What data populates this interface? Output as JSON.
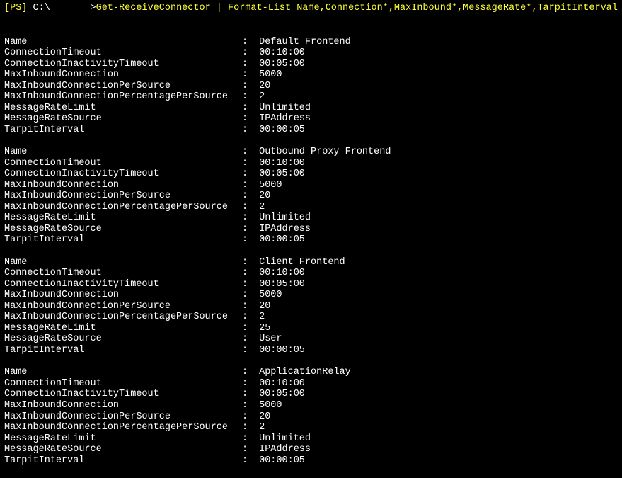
{
  "prompt": {
    "prefix": "[PS] ",
    "path": "C:\\",
    "gap": "       ",
    "marker": ">",
    "command": "Get-ReceiveConnector | Format-List Name,Connection*,MaxInbound*,MessageRate*,TarpitInterval"
  },
  "fields": [
    "Name",
    "ConnectionTimeout",
    "ConnectionInactivityTimeout",
    "MaxInboundConnection",
    "MaxInboundConnectionPerSource",
    "MaxInboundConnectionPercentagePerSource",
    "MessageRateLimit",
    "MessageRateSource",
    "TarpitInterval"
  ],
  "separator": ":",
  "records": [
    {
      "Name": "Default Frontend",
      "ConnectionTimeout": "00:10:00",
      "ConnectionInactivityTimeout": "00:05:00",
      "MaxInboundConnection": "5000",
      "MaxInboundConnectionPerSource": "20",
      "MaxInboundConnectionPercentagePerSource": "2",
      "MessageRateLimit": "Unlimited",
      "MessageRateSource": "IPAddress",
      "TarpitInterval": "00:00:05"
    },
    {
      "Name": "Outbound Proxy Frontend",
      "ConnectionTimeout": "00:10:00",
      "ConnectionInactivityTimeout": "00:05:00",
      "MaxInboundConnection": "5000",
      "MaxInboundConnectionPerSource": "20",
      "MaxInboundConnectionPercentagePerSource": "2",
      "MessageRateLimit": "Unlimited",
      "MessageRateSource": "IPAddress",
      "TarpitInterval": "00:00:05"
    },
    {
      "Name": "Client Frontend",
      "ConnectionTimeout": "00:10:00",
      "ConnectionInactivityTimeout": "00:05:00",
      "MaxInboundConnection": "5000",
      "MaxInboundConnectionPerSource": "20",
      "MaxInboundConnectionPercentagePerSource": "2",
      "MessageRateLimit": "25",
      "MessageRateSource": "User",
      "TarpitInterval": "00:00:05"
    },
    {
      "Name": "ApplicationRelay",
      "ConnectionTimeout": "00:10:00",
      "ConnectionInactivityTimeout": "00:05:00",
      "MaxInboundConnection": "5000",
      "MaxInboundConnectionPerSource": "20",
      "MaxInboundConnectionPercentagePerSource": "2",
      "MessageRateLimit": "Unlimited",
      "MessageRateSource": "IPAddress",
      "TarpitInterval": "00:00:05"
    }
  ]
}
